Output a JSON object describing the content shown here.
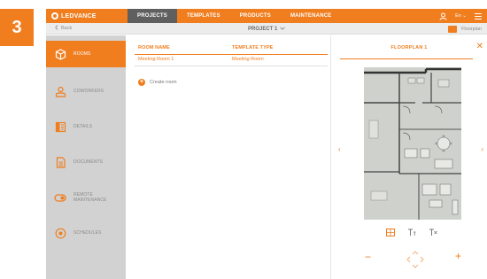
{
  "step_badge": "3",
  "topbar": {
    "logo_text": "LEDVANCE",
    "nav": [
      "PROJECTS",
      "TEMPLATES",
      "PRODUCTS",
      "MAINTENANCE"
    ],
    "active_nav": "PROJECTS",
    "language": "En ⌄",
    "icons": [
      "user-icon",
      "menu-icon"
    ]
  },
  "subbar": {
    "back_label": "Back",
    "project_title": "PROJECT 1",
    "floorplan_toggle_label": "Floorplan"
  },
  "sidebar": {
    "items": [
      {
        "label": "ROOMS",
        "icon": "cube-icon",
        "active": true
      },
      {
        "label": "COWORKERS",
        "icon": "people-icon",
        "active": false
      },
      {
        "label": "DETAILS",
        "icon": "details-icon",
        "active": false
      },
      {
        "label": "DOCUMENTS",
        "icon": "document-icon",
        "active": false
      },
      {
        "label": "REMOTE MAINTENANCE",
        "icon": "remote-icon",
        "active": false
      },
      {
        "label": "SCHEDULES",
        "icon": "schedule-icon",
        "active": false
      }
    ]
  },
  "rooms_table": {
    "columns": [
      "ROOM NAME",
      "TEMPLATE TYPE"
    ],
    "rows": [
      [
        "Meeting Room 1",
        "Meeting Room"
      ]
    ],
    "create_label": "Create room"
  },
  "floorplan": {
    "title": "FLOORPLAN 1",
    "close_symbol": "✕",
    "prev_symbol": "‹",
    "next_symbol": "›",
    "zoom_minus": "−",
    "zoom_plus": "+"
  },
  "colors": {
    "accent": "#f07d1e",
    "topnav_active": "#5f5f5f",
    "sidebar_bg": "#d2d2d2",
    "subbar_bg": "#ececec"
  }
}
